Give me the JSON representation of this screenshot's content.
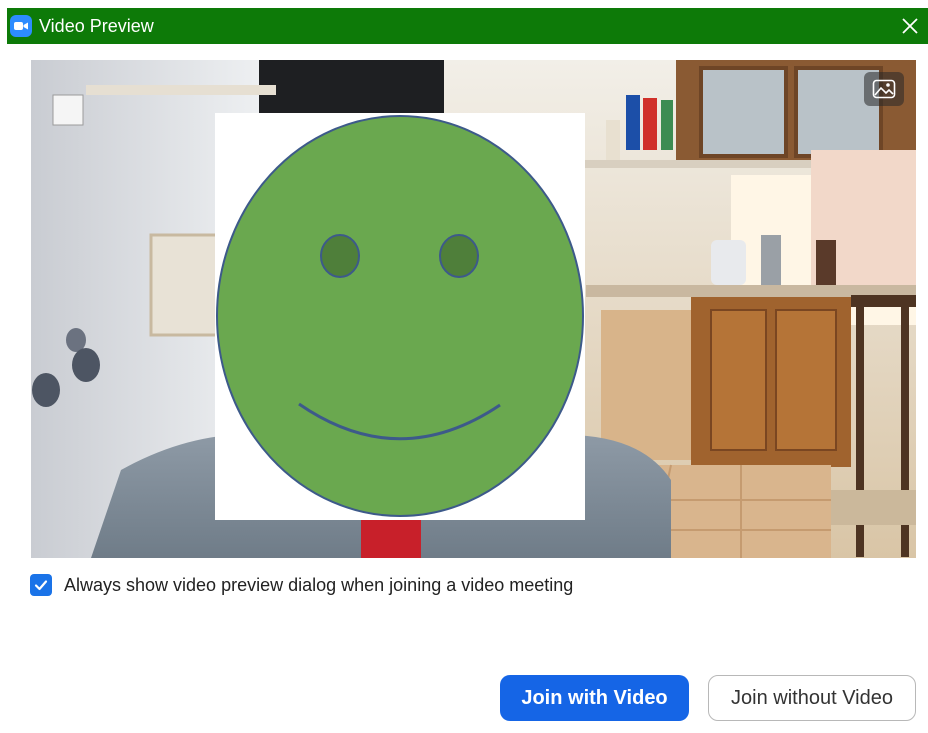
{
  "window": {
    "title": "Video Preview",
    "title_bar_color": "#0d7a08",
    "app_icon": "zoom-camera-icon",
    "close_icon": "close-icon"
  },
  "video": {
    "background_toggle_icon": "image-background-icon",
    "avatar": "smiley-face"
  },
  "preview_option": {
    "checked": true,
    "label": "Always show video preview dialog when joining a video meeting"
  },
  "buttons": {
    "join_with_video": "Join with Video",
    "join_without_video": "Join without Video"
  },
  "colors": {
    "accent": "#1565e6",
    "checkbox": "#1a73e8",
    "smiley_fill": "#6aa84f",
    "smiley_outline": "#3d5a8a"
  }
}
